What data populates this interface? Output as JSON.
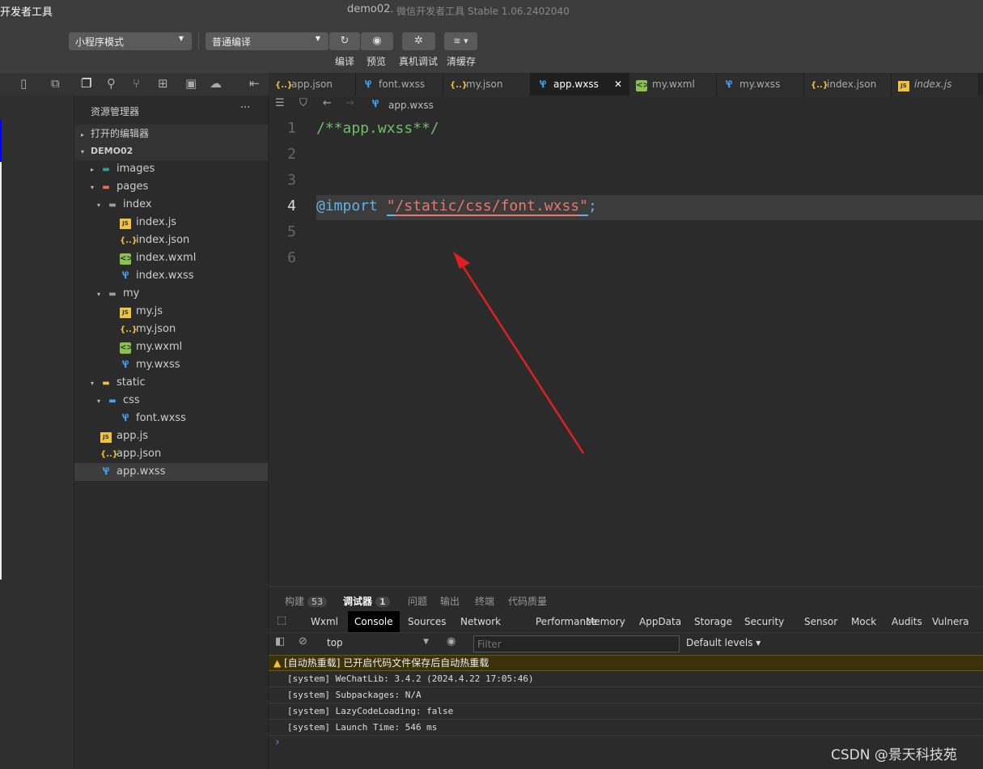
{
  "window": {
    "app_title_fragment": "开发者工具",
    "title": "demo02",
    "subtitle": "- 微信开发者工具 Stable 1.06.2402040"
  },
  "toolbar": {
    "mode": "小程序模式",
    "compile_mode": "普通编译",
    "compile": "编译",
    "preview": "预览",
    "remote_debug": "真机调试",
    "clear_cache": "清缓存"
  },
  "sidebar": {
    "title": "资源管理器",
    "more": "···",
    "open_editors": "打开的编辑器",
    "project": "DEMO02",
    "tree": [
      {
        "label": "images",
        "type": "folder-images",
        "depth": 1,
        "twisty": "▸"
      },
      {
        "label": "pages",
        "type": "folder-pages",
        "depth": 1,
        "twisty": "▾"
      },
      {
        "label": "index",
        "type": "folder",
        "depth": 2,
        "twisty": "▾"
      },
      {
        "label": "index.js",
        "type": "js",
        "depth": 3
      },
      {
        "label": "index.json",
        "type": "json",
        "depth": 3
      },
      {
        "label": "index.wxml",
        "type": "wxml",
        "depth": 3
      },
      {
        "label": "index.wxss",
        "type": "wxss",
        "depth": 3
      },
      {
        "label": "my",
        "type": "folder",
        "depth": 2,
        "twisty": "▾"
      },
      {
        "label": "my.js",
        "type": "js",
        "depth": 3
      },
      {
        "label": "my.json",
        "type": "json",
        "depth": 3
      },
      {
        "label": "my.wxml",
        "type": "wxml",
        "depth": 3
      },
      {
        "label": "my.wxss",
        "type": "wxss",
        "depth": 3
      },
      {
        "label": "static",
        "type": "folder-open",
        "depth": 1,
        "twisty": "▾"
      },
      {
        "label": "css",
        "type": "folder-css",
        "depth": 2,
        "twisty": "▾"
      },
      {
        "label": "font.wxss",
        "type": "wxss",
        "depth": 3
      },
      {
        "label": "app.js",
        "type": "js",
        "depth": 1
      },
      {
        "label": "app.json",
        "type": "json",
        "depth": 1
      },
      {
        "label": "app.wxss",
        "type": "wxss",
        "depth": 1,
        "selected": true
      }
    ]
  },
  "tabs": [
    {
      "label": "app.json",
      "type": "json"
    },
    {
      "label": "font.wxss",
      "type": "wxss"
    },
    {
      "label": "my.json",
      "type": "json"
    },
    {
      "label": "app.wxss",
      "type": "wxss",
      "active": true
    },
    {
      "label": "my.wxml",
      "type": "wxml"
    },
    {
      "label": "my.wxss",
      "type": "wxss"
    },
    {
      "label": "index.json",
      "type": "json"
    },
    {
      "label": "index.js",
      "type": "js"
    }
  ],
  "breadcrumb": "app.wxss",
  "editor": {
    "lines": [
      {
        "n": "1",
        "parts": [
          {
            "t": "/**app.wxss**/",
            "c": "#6dbf67"
          }
        ]
      },
      {
        "n": "2",
        "parts": []
      },
      {
        "n": "3",
        "parts": []
      },
      {
        "n": "4",
        "parts": [
          {
            "t": "@import ",
            "c": "#5fb3e6"
          },
          {
            "t": "\"",
            "c": "#e8776e"
          },
          {
            "t": "/static/css/font.wxss",
            "c": "#e8776e"
          },
          {
            "t": "\"",
            "c": "#e8776e"
          },
          {
            "t": ";",
            "c": "#5fb3e6"
          }
        ],
        "current": true
      },
      {
        "n": "5",
        "parts": []
      },
      {
        "n": "6",
        "parts": []
      }
    ]
  },
  "panel": {
    "tabs": [
      {
        "label": "构建",
        "badge": "53"
      },
      {
        "label": "调试器",
        "badge": "1",
        "active": true
      },
      {
        "label": "问题"
      },
      {
        "label": "输出"
      },
      {
        "label": "终端"
      },
      {
        "label": "代码质量"
      }
    ],
    "devtools_tabs": [
      "Wxml",
      "Console",
      "Sources",
      "Network",
      "Performance",
      "Memory",
      "AppData",
      "Storage",
      "Security",
      "Sensor",
      "Mock",
      "Audits",
      "Vulnera"
    ],
    "active_devtool": "Console",
    "context": "top",
    "filter_placeholder": "Filter",
    "levels": "Default levels ▾",
    "warning": "[自动热重载] 已开启代码文件保存后自动热重载",
    "logs": [
      "[system] WeChatLib: 3.4.2 (2024.4.22 17:05:46)",
      "[system] Subpackages: N/A",
      "[system] LazyCodeLoading: false",
      "[system] Launch Time: 546 ms"
    ],
    "prompt": "›"
  },
  "watermark": "CSDN @景天科技苑"
}
